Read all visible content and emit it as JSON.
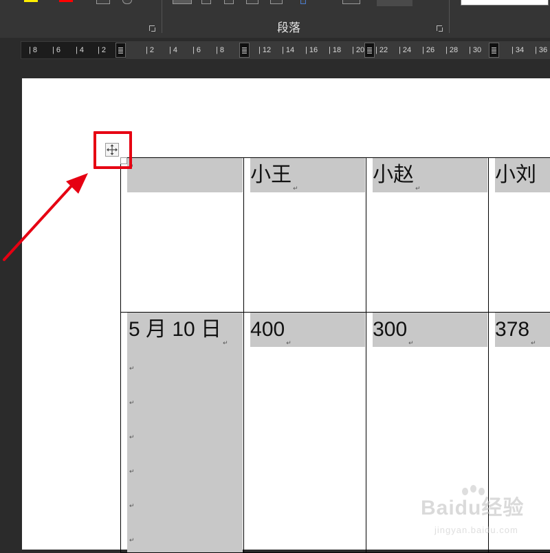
{
  "ribbon": {
    "paragraph_group_label": "段落"
  },
  "ruler": {
    "ticks": [
      "8",
      "6",
      "4",
      "2",
      "2",
      "4",
      "6",
      "8",
      "12",
      "14",
      "16",
      "18",
      "20",
      "22",
      "24",
      "26",
      "28",
      "30",
      "34",
      "36"
    ]
  },
  "table": {
    "header_row": [
      "",
      "小王",
      "小赵",
      "小刘"
    ],
    "row1": [
      "5 月 10 日",
      "400",
      "300",
      "378"
    ],
    "paragraph_mark": "↵"
  },
  "watermark": {
    "main": "Baidu经验",
    "sub": "jingyan.baidu.com"
  },
  "colors": {
    "highlight": "#e60012",
    "cell_shading": "#c8c8c8",
    "ribbon_bg": "#353535"
  }
}
